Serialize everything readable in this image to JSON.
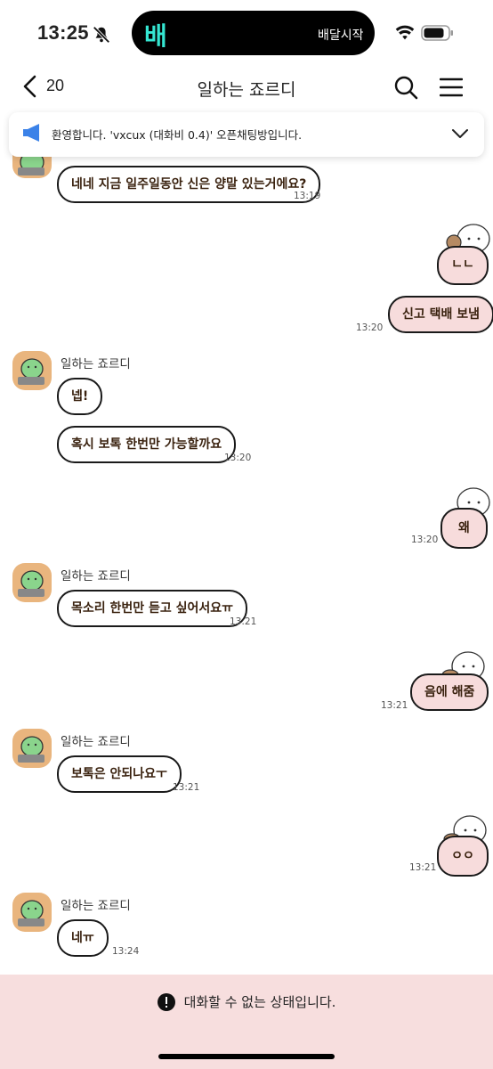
{
  "status_bar": {
    "time": "13:25",
    "island_logo": "배",
    "island_text": "배달시작",
    "icons": [
      "bell-slash-icon",
      "wifi-icon",
      "battery-icon"
    ]
  },
  "header": {
    "back_count": "20",
    "title": "일하는 죠르디",
    "icons": [
      "chevron-left-icon",
      "search-icon",
      "menu-icon"
    ]
  },
  "notice": {
    "text": "환영합니다. 'vxcux (대화비 0.4)' 오픈채팅방입니다.",
    "icons": [
      "megaphone-icon",
      "chevron-down-icon"
    ]
  },
  "sender_name": "일하는 죠르디",
  "messages": [
    {
      "text": "네네 지금 일주일동안 신은 양말 있는거에요?",
      "time": "13:19"
    },
    {
      "text": "ㄴㄴ",
      "time": ""
    },
    {
      "text": "신고 택배 보냄",
      "time": "13:20"
    },
    {
      "text": "넵!",
      "time": ""
    },
    {
      "text": "혹시 보톡 한번만 가능할까요",
      "time": "13:20"
    },
    {
      "text": "왜",
      "time": "13:20"
    },
    {
      "text": "목소리 한번만 듣고 싶어서요ㅠ",
      "time": "13:21"
    },
    {
      "text": "음에 해줌",
      "time": "13:21"
    },
    {
      "text": "보톡은 안되나요ㅜ",
      "time": "13:21"
    },
    {
      "text": "ㅇㅇ",
      "time": "13:21"
    },
    {
      "text": "네ㅠ",
      "time": "13:24"
    }
  ],
  "footer": {
    "text": "대화할 수 없는 상태입니다.",
    "icon": "exclamation-circle-icon"
  },
  "colors": {
    "island_logo": "#35e6d2",
    "megaphone": "#3b82e8",
    "my_bubble": "#f7dcdc",
    "footer_bg": "#f7dede",
    "avatar_bg": "#e9b57e"
  }
}
